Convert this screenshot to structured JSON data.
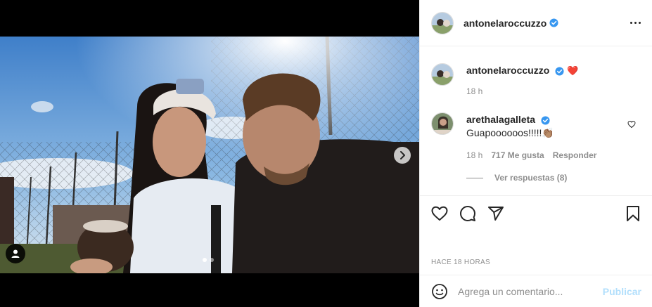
{
  "post": {
    "author": "antonelaroccuzzo",
    "more_icon": "more-horizontal-icon",
    "image_alt": "Selfie de Antonela y Lionel en un campo deportivo",
    "carousel": {
      "current": 1,
      "total": 2
    }
  },
  "caption": {
    "username": "antonelaroccuzzo",
    "emoji": "❤️",
    "time": "18 h"
  },
  "comment": {
    "username": "arethalagalleta",
    "text": "Guapoooooos!!!!!👏🏽",
    "time": "18 h",
    "likes": "717 Me gusta",
    "reply": "Responder",
    "view_replies": "Ver respuestas (8)"
  },
  "actions": {
    "like": "heart-icon",
    "comment": "comment-icon",
    "share": "paper-plane-icon",
    "save": "bookmark-icon"
  },
  "timestamp": "HACE 18 HORAS",
  "composer": {
    "placeholder": "Agrega un comentario...",
    "publish": "Publicar"
  },
  "colors": {
    "verified": "#3897f0",
    "heart_red": "#ed4956",
    "publish_disabled": "#b2dffc",
    "muted": "#8e8e8e"
  }
}
